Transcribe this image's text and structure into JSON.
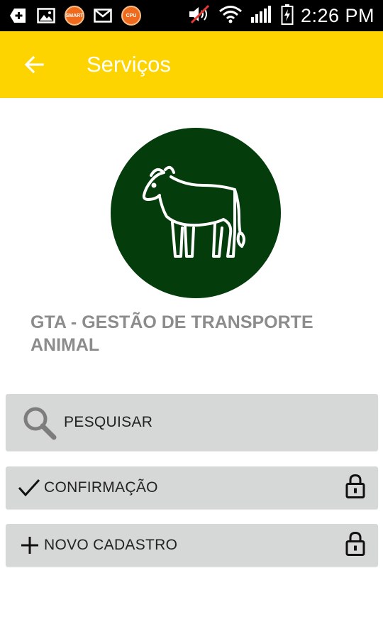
{
  "status_bar": {
    "time": "2:26 PM",
    "notification_icons": [
      "plus-badge-icon",
      "image-icon",
      "app-icon-1",
      "mail-icon",
      "app-icon-2"
    ],
    "round_icon_texts": [
      "SMART",
      "CPU"
    ],
    "system_icons": [
      "muted-volume-icon",
      "wifi-icon",
      "signal-icon",
      "battery-charging-icon"
    ]
  },
  "app_bar": {
    "title": "Serviços",
    "back_icon": "arrow-left-icon",
    "background": "#fdd400"
  },
  "service": {
    "title": "GTA - GESTÃO DE TRANSPORTE ANIMAL",
    "icon": "cow-icon",
    "icon_background": "#043d0b"
  },
  "actions": [
    {
      "label": "PESQUISAR",
      "icon": "search-icon",
      "locked": false
    },
    {
      "label": "CONFIRMAÇÃO",
      "icon": "check-icon",
      "locked": true
    },
    {
      "label": "NOVO CADASTRO",
      "icon": "plus-icon",
      "locked": true
    }
  ]
}
